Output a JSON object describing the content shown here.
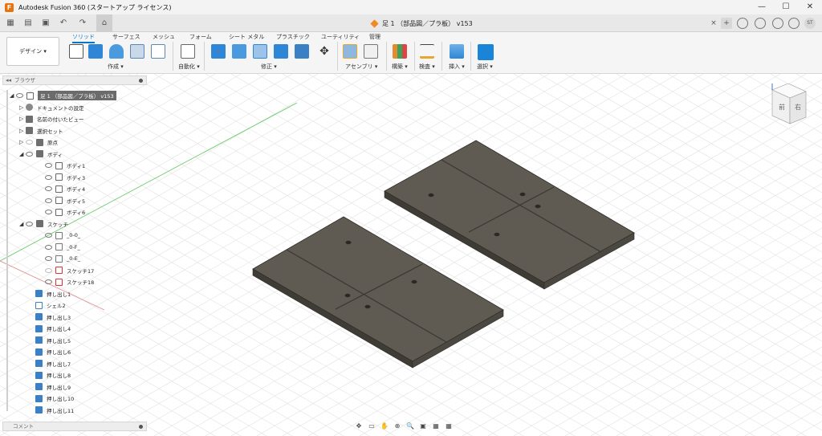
{
  "window": {
    "title": "Autodesk Fusion 360 (スタートアップ ライセンス)",
    "app_icon": "F",
    "minimize": "—",
    "maximize": "☐",
    "close": "✕"
  },
  "qat": {
    "grid": "▦",
    "file": "▤",
    "save": "▣",
    "undo": "↶",
    "redo": "↷",
    "home": "⌂"
  },
  "document": {
    "tab_title": "足 1 （部品図／プラ板） v153",
    "close": "×",
    "new_tab": "+",
    "user": "ST"
  },
  "ribbon": {
    "workspace": "デザイン ▾",
    "tabs": [
      "ソリッド",
      "サーフェス",
      "メッシュ",
      "フォーム",
      "シート メタル",
      "プラスチック",
      "ユーティリティ",
      "管理"
    ],
    "groups": [
      "作成 ▾",
      "自動化 ▾",
      "修正 ▾",
      "アセンブリ ▾",
      "構築 ▾",
      "検査 ▾",
      "挿入 ▾",
      "選択 ▾"
    ]
  },
  "browser": {
    "header": "ブラウザ",
    "root": "足 1 （部品図／プラ板） v153",
    "items": [
      {
        "label": "ドキュメントの設定"
      },
      {
        "label": "名前の付いたビュー"
      },
      {
        "label": "選択セット"
      },
      {
        "label": "原点"
      },
      {
        "label": "ボディ"
      },
      {
        "label": "ボディ1"
      },
      {
        "label": "ボディ3"
      },
      {
        "label": "ボディ4"
      },
      {
        "label": "ボディ5"
      },
      {
        "label": "ボディ6"
      },
      {
        "label": "スケッチ"
      },
      {
        "label": "_0-0_"
      },
      {
        "label": "_0-F_"
      },
      {
        "label": "_0-E_"
      },
      {
        "label": "スケッチ17"
      },
      {
        "label": "スケッチ18"
      },
      {
        "label": "押し出し1"
      },
      {
        "label": "シェル2"
      },
      {
        "label": "押し出し3"
      },
      {
        "label": "押し出し4"
      },
      {
        "label": "押し出し5"
      },
      {
        "label": "押し出し6"
      },
      {
        "label": "押し出し7"
      },
      {
        "label": "押し出し8"
      },
      {
        "label": "押し出し9"
      },
      {
        "label": "押し出し10"
      },
      {
        "label": "押し出し11"
      }
    ]
  },
  "comments": {
    "label": "コメント"
  },
  "viewcube": {
    "front": "前",
    "right": "右"
  },
  "navbar": [
    "✥",
    "▭",
    "✋",
    "⊕",
    "🔍",
    "▣",
    "▦",
    "▦"
  ],
  "colors": {
    "accent": "#0a74c9",
    "part": "#5c5850",
    "part_dark": "#3e3b35"
  }
}
